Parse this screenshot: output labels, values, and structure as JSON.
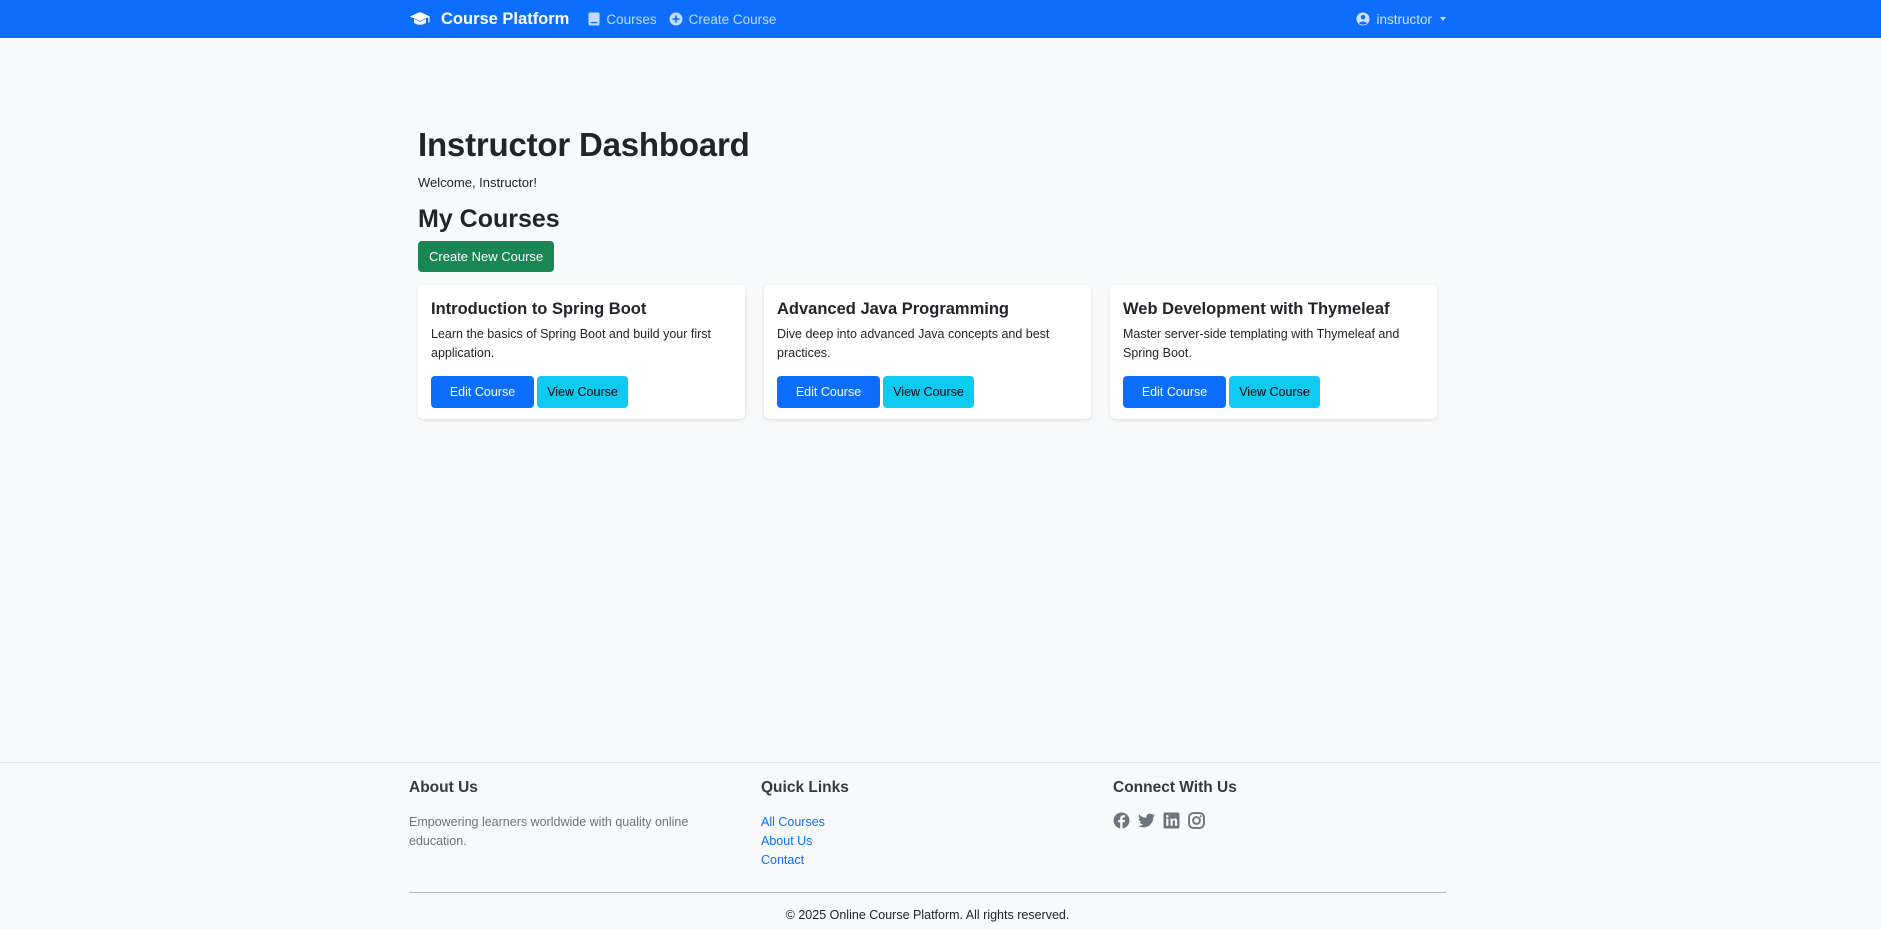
{
  "navbar": {
    "brand": "Course Platform",
    "brand_icon": "graduation-cap-icon",
    "links": [
      {
        "label": "Courses",
        "icon": "book-icon"
      },
      {
        "label": "Create Course",
        "icon": "plus-circle-icon"
      }
    ],
    "user": {
      "label": "instructor",
      "icon": "user-circle-icon"
    },
    "colors": {
      "background": "#0d6efd"
    }
  },
  "main": {
    "title": "Instructor Dashboard",
    "welcome": "Welcome, Instructor!",
    "section_title": "My Courses",
    "create_button": "Create New Course",
    "courses": [
      {
        "title": "Introduction to Spring Boot",
        "description": "Learn the basics of Spring Boot and build your first application.",
        "edit_label": "Edit Course",
        "view_label": "View Course"
      },
      {
        "title": "Advanced Java Programming",
        "description": "Dive deep into advanced Java concepts and best practices.",
        "edit_label": "Edit Course",
        "view_label": "View Course"
      },
      {
        "title": "Web Development with Thymeleaf",
        "description": "Master server-side templating with Thymeleaf and Spring Boot.",
        "edit_label": "Edit Course",
        "view_label": "View Course"
      }
    ],
    "colors": {
      "create": "#198754",
      "edit": "#0d6efd",
      "view": "#0dcaf0"
    }
  },
  "footer": {
    "about": {
      "title": "About Us",
      "text": "Empowering learners worldwide with quality online education."
    },
    "quick_links": {
      "title": "Quick Links",
      "links": [
        "All Courses",
        "About Us",
        "Contact"
      ]
    },
    "connect": {
      "title": "Connect With Us",
      "icons": [
        "facebook-icon",
        "twitter-icon",
        "linkedin-icon",
        "instagram-icon"
      ]
    },
    "copyright": "© 2025 Online Course Platform. All rights reserved."
  }
}
